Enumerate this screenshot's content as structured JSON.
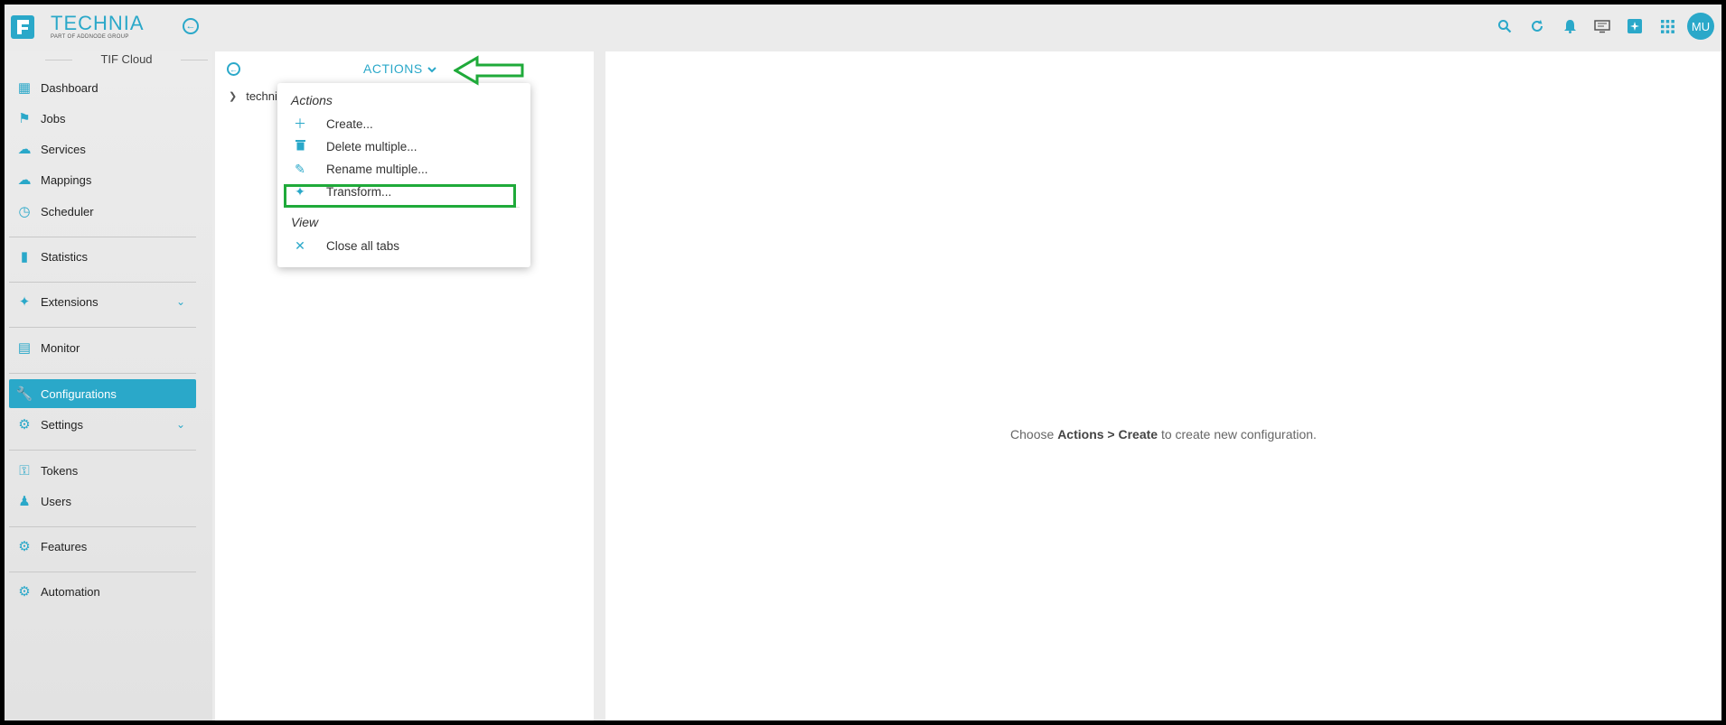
{
  "brand": {
    "name": "TECHNIA",
    "sub": "PART OF ADDNODE GROUP"
  },
  "topbar": {
    "icons": [
      "search-icon",
      "refresh-icon",
      "bell-icon",
      "monitor-icon",
      "sparkle-icon",
      "grid-icon"
    ],
    "user_initials": "MU"
  },
  "sidebar": {
    "tenant": "TIF Cloud",
    "items": [
      {
        "label": "Dashboard",
        "icon": "dashboard-icon"
      },
      {
        "label": "Jobs",
        "icon": "tag-icon"
      },
      {
        "label": "Services",
        "icon": "cloud-icon"
      },
      {
        "label": "Mappings",
        "icon": "cloud-outline-icon"
      },
      {
        "label": "Scheduler",
        "icon": "clock-icon"
      },
      {
        "label": "Statistics",
        "icon": "bar-chart-icon"
      },
      {
        "label": "Extensions",
        "icon": "puzzle-icon"
      },
      {
        "label": "Monitor",
        "icon": "pulse-icon"
      },
      {
        "label": "Configurations",
        "icon": "wrench-icon"
      },
      {
        "label": "Settings",
        "icon": "gear-icon"
      },
      {
        "label": "Tokens",
        "icon": "key-icon"
      },
      {
        "label": "Users",
        "icon": "users-icon"
      },
      {
        "label": "Features",
        "icon": "feature-gear-icon"
      },
      {
        "label": "Automation",
        "icon": "automation-gear-icon"
      }
    ],
    "active": "Configurations"
  },
  "left_panel": {
    "actions_label": "ACTIONS",
    "tree_item": "techni"
  },
  "menu": {
    "section_actions": "Actions",
    "create": "Create...",
    "delete_multiple": "Delete multiple...",
    "rename_multiple": "Rename multiple...",
    "transform": "Transform...",
    "section_view": "View",
    "close_all_tabs": "Close all tabs"
  },
  "right_panel": {
    "msg_prefix": "Choose ",
    "msg_bold": "Actions > Create",
    "msg_suffix": " to create new configuration."
  },
  "colors": {
    "accent": "#2aa8c9",
    "highlight": "#1faa3a"
  }
}
